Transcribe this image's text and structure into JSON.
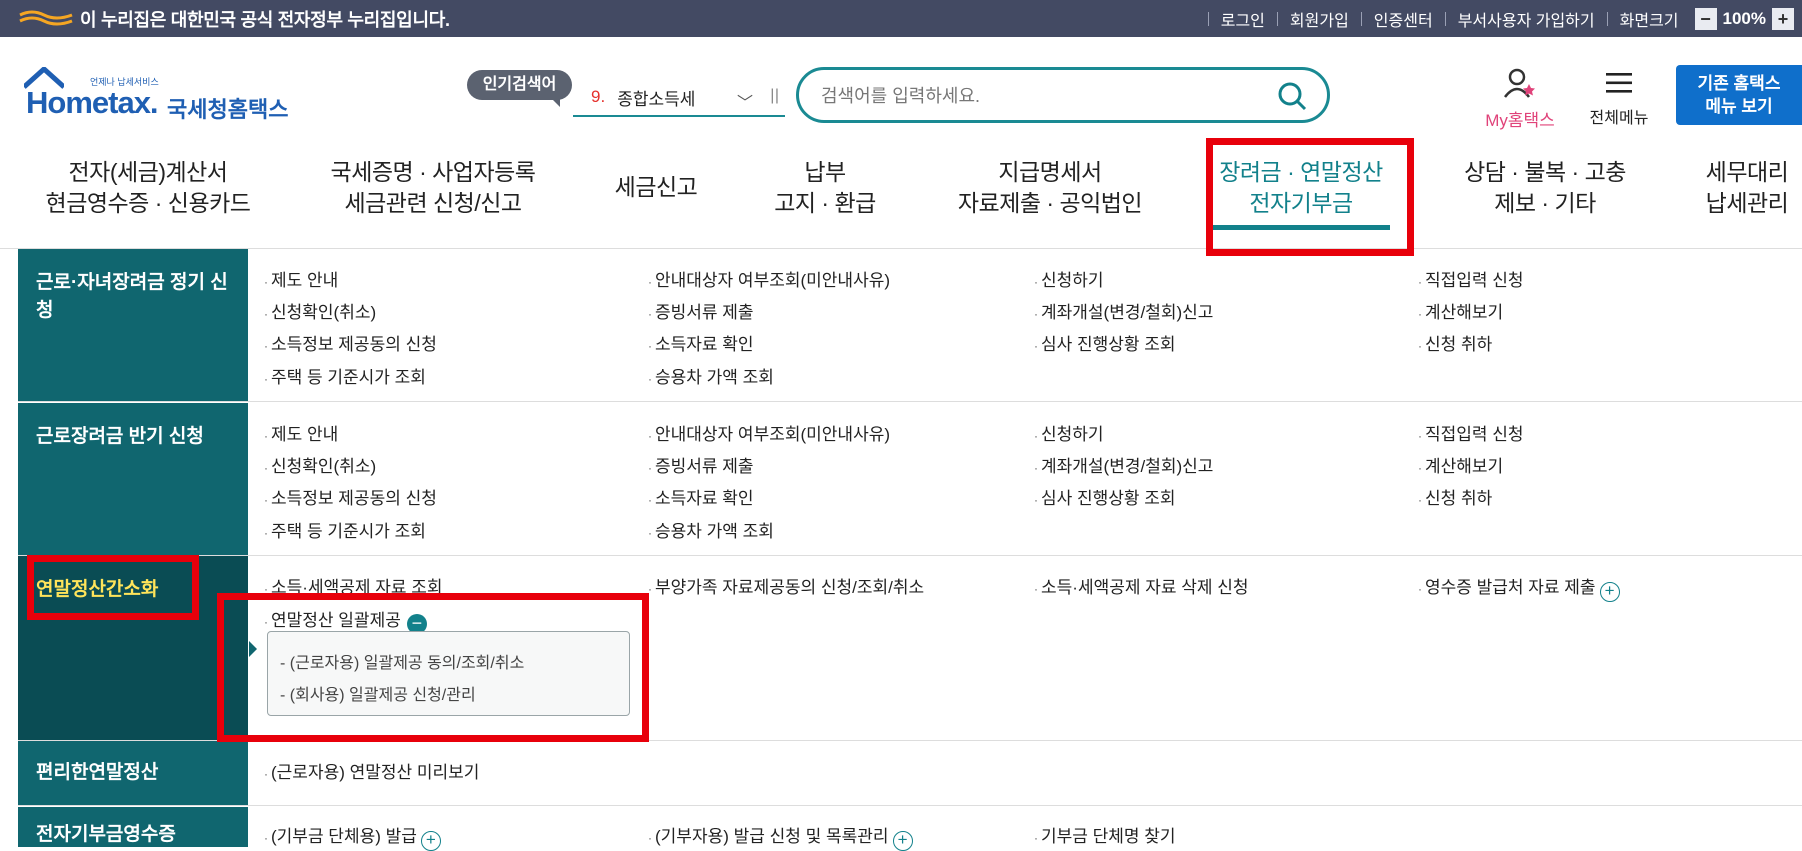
{
  "gov_banner": {
    "text": "이 누리집은 대한민국 공식 전자정부 누리집입니다.",
    "links": [
      "로그인",
      "회원가입",
      "인증센터",
      "부서사용자 가입하기",
      "화면크기"
    ],
    "zoom_value": "100%",
    "zoom_minus": "−",
    "zoom_plus": "+"
  },
  "header": {
    "logo_sub": "언제나 납세서비스",
    "logo_main": "Hometax.",
    "logo_kr": "국세청홈택스",
    "popular_label": "인기검색어",
    "popular_rank": "9.",
    "popular_keyword": "종합소득세",
    "search_placeholder": "검색어를 입력하세요.",
    "my_hometax": "My홈택스",
    "all_menu": "전체메뉴",
    "old_home_line1": "기존 홈택스",
    "old_home_line2": "메뉴 보기"
  },
  "gnb": [
    {
      "line1": "전자(세금)계산서",
      "line2": "현금영수증 · 신용카드"
    },
    {
      "line1": "국세증명 · 사업자등록",
      "line2": "세금관련 신청/신고"
    },
    {
      "line1": "세금신고",
      "line2": ""
    },
    {
      "line1": "납부",
      "line2": "고지 · 환급"
    },
    {
      "line1": "지급명세서",
      "line2": "자료제출 · 공익법인"
    },
    {
      "line1": "장려금 · 연말정산",
      "line2": "전자기부금"
    },
    {
      "line1": "상담 · 불복 · 고충",
      "line2": "제보 · 기타"
    },
    {
      "line1": "세무대리",
      "line2": "납세관리"
    }
  ],
  "sections": {
    "s1": {
      "title": "근로·자녀장려금 정기 신청",
      "items": [
        "제도 안내",
        "안내대상자 여부조회(미안내사유)",
        "신청하기",
        "직접입력 신청",
        "신청확인(취소)",
        "증빙서류 제출",
        "계좌개설(변경/철회)신고",
        "계산해보기",
        "소득정보 제공동의 신청",
        "소득자료 확인",
        "심사 진행상황 조회",
        "신청 취하",
        "주택 등 기준시가 조회",
        "승용차 가액 조회"
      ]
    },
    "s2": {
      "title": "근로장려금 반기 신청",
      "items": [
        "제도 안내",
        "안내대상자 여부조회(미안내사유)",
        "신청하기",
        "직접입력 신청",
        "신청확인(취소)",
        "증빙서류 제출",
        "계좌개설(변경/철회)신고",
        "계산해보기",
        "소득정보 제공동의 신청",
        "소득자료 확인",
        "심사 진행상황 조회",
        "신청 취하",
        "주택 등 기준시가 조회",
        "승용차 가액 조회"
      ]
    },
    "s3": {
      "title": "연말정산간소화",
      "items": [
        "소득·세액공제 자료 조회",
        "부양가족 자료제공동의 신청/조회/취소",
        "소득·세액공제 자료 삭제 신청",
        "영수증 발급처 자료 제출",
        "연말정산 일괄제공"
      ],
      "sub": [
        "- (근로자용) 일괄제공 동의/조회/취소",
        "- (회사용) 일괄제공 신청/관리"
      ]
    },
    "s4": {
      "title": "편리한연말정산",
      "items": [
        "(근로자용) 연말정산 미리보기"
      ]
    },
    "s5": {
      "title": "전자기부금영수증",
      "items": [
        "(기부금 단체용) 발급",
        "(기부자용) 발급 신청 및 목록관리",
        "기부금 단체명 찾기"
      ]
    }
  },
  "colors": {
    "accent_teal": "#12818b",
    "sidebar_teal": "#10666f",
    "highlight_red": "#e8000b",
    "banner_navy": "#434a63",
    "old_home_blue": "#0f6fcb"
  }
}
